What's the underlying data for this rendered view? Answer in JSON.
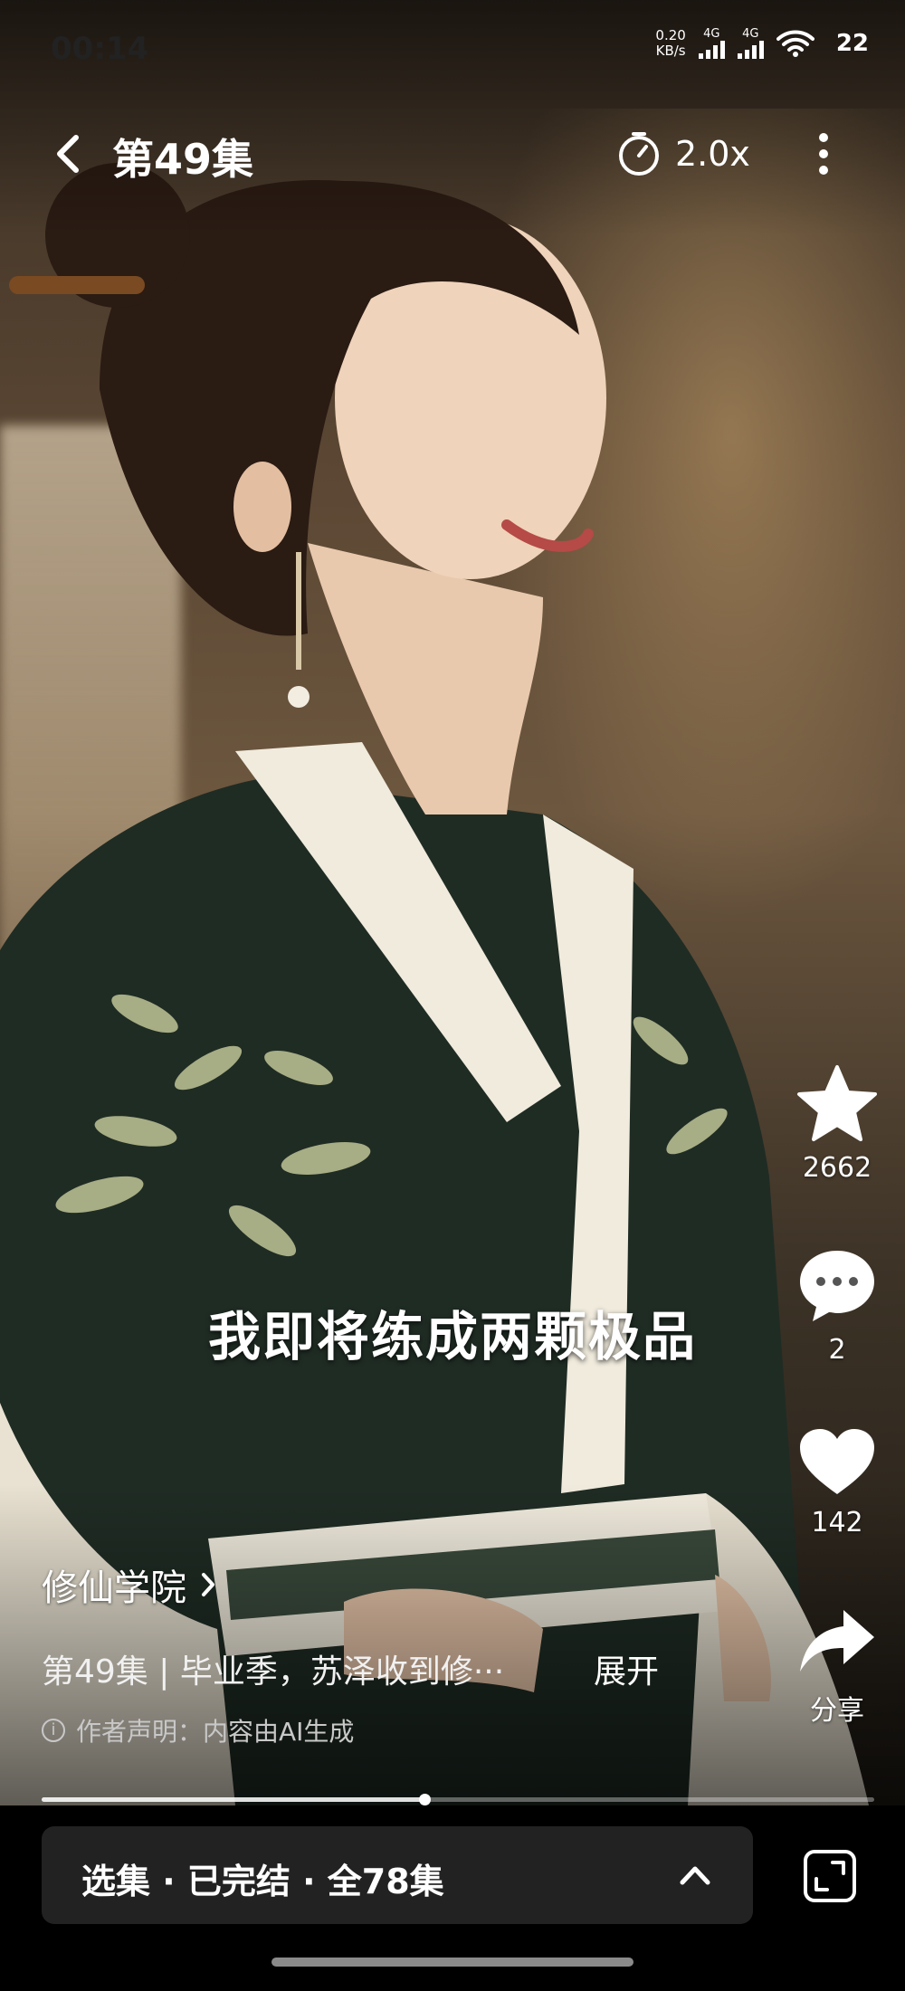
{
  "status_bar": {
    "time": "00:14",
    "net_speed_value": "0.20",
    "net_speed_unit": "KB/s",
    "sim1_label": "4G",
    "sim2_label": "4G",
    "battery": "22"
  },
  "top_bar": {
    "episode_title": "第49集",
    "speed": "2.0x",
    "icons": [
      "back-chevron-icon",
      "speed-timer-icon",
      "more-vertical-icon"
    ]
  },
  "video": {
    "subtitle": "我即将练成两颗极品",
    "progress": 0.46
  },
  "actions": [
    {
      "name": "favorite",
      "icon": "star-icon",
      "count": "2662"
    },
    {
      "name": "comment",
      "icon": "comment-icon",
      "count": "2"
    },
    {
      "name": "like",
      "icon": "heart-icon",
      "count": "142"
    },
    {
      "name": "share",
      "icon": "share-arrow-icon",
      "count": "分享"
    }
  ],
  "info": {
    "series_name": "修仙学院",
    "description": "第49集 | 毕业季，苏泽收到修···",
    "expand_label": "展开",
    "disclaimer": "作者声明：内容由AI生成"
  },
  "bottom_bar": {
    "episode_selector": "选集 · 已完结 · 全78集"
  },
  "colors": {
    "bottom_panel": "#222222",
    "background": "#000000",
    "text": "#ffffff"
  }
}
